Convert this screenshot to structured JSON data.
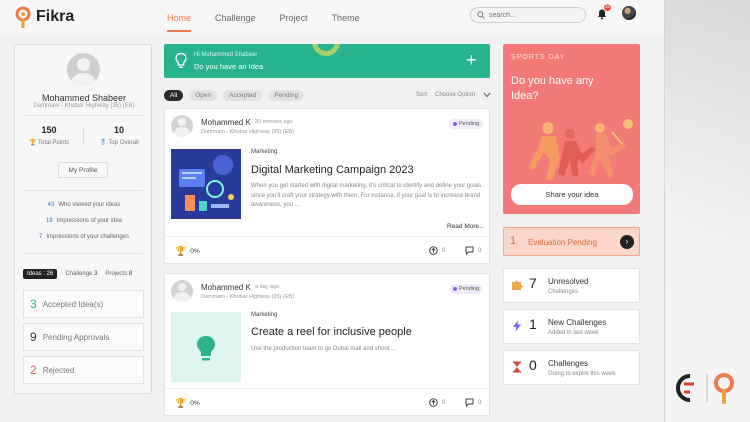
{
  "header": {
    "logo_text": "Fikra",
    "nav": [
      "Home",
      "Challenge",
      "Project",
      "Theme"
    ],
    "search_placeholder": "search...",
    "notification_count": "10",
    "accent": "#f07a4a"
  },
  "profile": {
    "name": "Mohammed Shabeer",
    "location": "Dammam - Khobar Highway (35) (EB)",
    "total_points": "150",
    "total_points_label": "Total Points",
    "top_overall": "10",
    "top_overall_label": "Top Overall",
    "my_profile_label": "My Profile",
    "links": [
      {
        "count": "43",
        "label": "Who viewed your ideas"
      },
      {
        "count": "19",
        "label": "Impressions of your idea"
      },
      {
        "count": "7",
        "label": "Impressions of your challenges"
      }
    ],
    "tabs": [
      {
        "label": "Ideas : 26"
      },
      {
        "label": "Challenge",
        "count": "3"
      },
      {
        "label": "Projects",
        "count": "8"
      }
    ],
    "idea_stats": [
      {
        "count": "3",
        "label": "Accepted Idea(s)",
        "color": "#27b38e"
      },
      {
        "count": "9",
        "label": "Pending Approvals",
        "color": "#333333"
      },
      {
        "count": "2",
        "label": "Rejected",
        "color": "#e85a5a"
      }
    ]
  },
  "banner": {
    "greeting": "Hi Mohammed Shabeer",
    "question": "Do you have an Idea",
    "plus": "+",
    "color": "#27b38e"
  },
  "filters": {
    "chips": [
      "All",
      "Open",
      "Accepted",
      "Pending"
    ],
    "sort_label": "Sort",
    "sort_value": "Choose Option"
  },
  "posts": [
    {
      "author": "Mohammed K",
      "time": "30 minutes ago",
      "location": "Dammam - Khobar Highway (35) (EB)",
      "status": "Pending",
      "category": "Marketing",
      "title": "Digital Marketing Campaign 2023",
      "description": "When you get started with digital marketing, it's critical to identify and define your goals since you'll craft your strategy with them. For instance, if your goal is to increase brand awareness, you ...",
      "read_more": "Read More...",
      "percent": "0%",
      "upvotes": "0",
      "comments": "0"
    },
    {
      "author": "Mohammed K",
      "time": "a day ago",
      "location": "Dammam - Khobar Highway (35) (EB)",
      "status": "Pending",
      "category": "Marketing",
      "title": "Create a reel for inclusive people",
      "description": "Use the production team to go Dubai mall and shoot ...",
      "percent": "0%",
      "upvotes": "0",
      "comments": "0"
    }
  ],
  "promo": {
    "label": "SPORTS DAY",
    "question": "Do you have any Idea?",
    "button": "Share your idea",
    "color": "#f47a78"
  },
  "evaluation": {
    "count": "1",
    "label": "Evaluation Pending",
    "arrow": "›"
  },
  "challenge_stats": [
    {
      "count": "7",
      "title": "Unresolved",
      "subtitle": "Challenges",
      "icon": "puzzle-icon"
    },
    {
      "count": "1",
      "title": "New Challenges",
      "subtitle": "Added in last week",
      "icon": "lightning-icon"
    },
    {
      "count": "0",
      "title": "Challenges",
      "subtitle": "Going to expire this week",
      "icon": "hourglass-icon"
    }
  ]
}
